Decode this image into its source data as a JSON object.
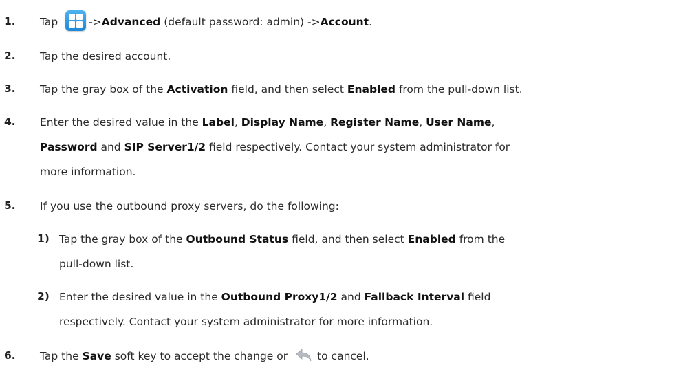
{
  "steps": [
    {
      "num": "1.",
      "parts": [
        "Tap",
        "->",
        "Advanced",
        "(default password: admin) ->",
        "Account",
        "."
      ]
    },
    {
      "num": "2.",
      "text": "Tap the desired account."
    },
    {
      "num": "3.",
      "parts": [
        "Tap the gray box of the ",
        "Activation",
        " field, and then select ",
        "Enabled",
        " from the pull-down list."
      ]
    },
    {
      "num": "4.",
      "parts": [
        "Enter the desired value in the ",
        "Label",
        ", ",
        "Display Name",
        ", ",
        "Register Name",
        ", ",
        "User Name",
        ",",
        "Password",
        " and ",
        "SIP Server1/2",
        " field respectively. Contact your system administrator for",
        "more information."
      ]
    },
    {
      "num": "5.",
      "text": "If you use the outbound proxy servers, do the following:"
    },
    {
      "num": "1)",
      "parts": [
        "Tap the gray box of the ",
        "Outbound Status",
        " field, and then select ",
        "Enabled",
        " from the",
        "pull-down list."
      ]
    },
    {
      "num": "2)",
      "parts": [
        "Enter the desired value in the ",
        "Outbound Proxy1/2",
        " and ",
        "Fallback Interval",
        " field",
        "respectively. Contact your system administrator for more information."
      ]
    },
    {
      "num": "6.",
      "parts": [
        "Tap the ",
        "Save",
        " soft key to accept the change or",
        "to cancel."
      ]
    }
  ],
  "icons": {
    "menu": "menu-grid-icon",
    "back": "back-arrow-icon"
  }
}
